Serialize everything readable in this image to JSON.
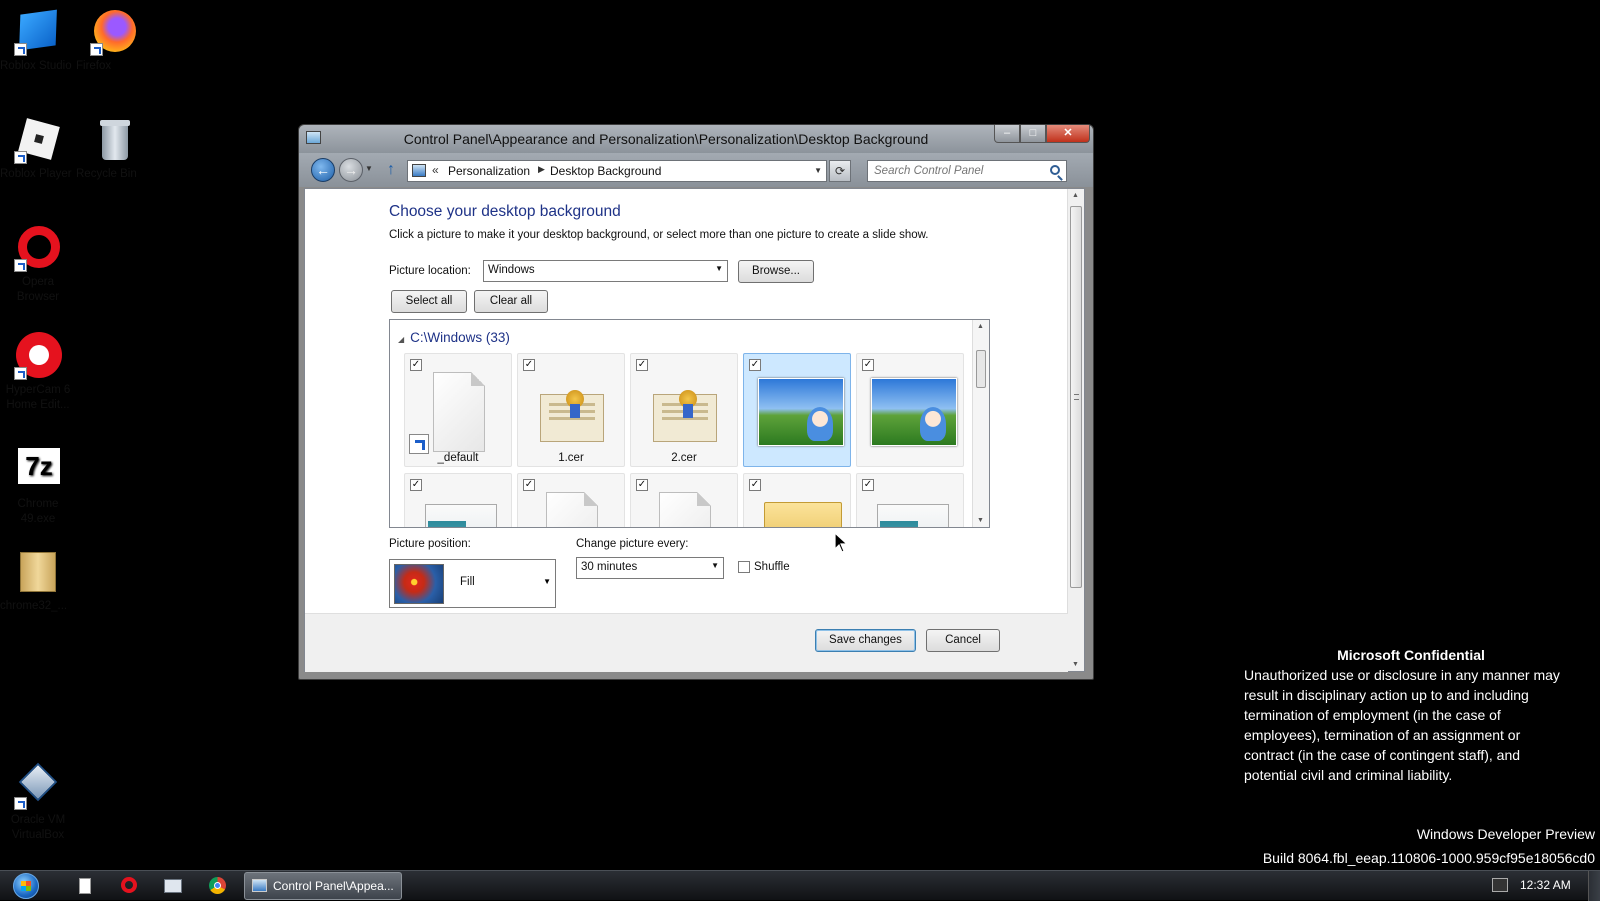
{
  "desktop": {
    "icons": [
      {
        "label": "Roblox Studio",
        "icon": "roblox-studio-icon"
      },
      {
        "label": "Firefox",
        "icon": "firefox-icon"
      },
      {
        "label": "Roblox Player",
        "icon": "roblox-player-icon"
      },
      {
        "label": "Recycle Bin",
        "icon": "recycle-bin-icon"
      },
      {
        "label": "Opera Browser",
        "icon": "opera-icon"
      },
      {
        "label": "HyperCam 6 Home Edit...",
        "icon": "hypercam-icon"
      },
      {
        "label": "Chrome 49.exe",
        "icon": "7zip-icon"
      },
      {
        "label": "chrome32_...",
        "icon": "folder-icon"
      },
      {
        "label": "Oracle VM VirtualBox",
        "icon": "virtualbox-icon"
      }
    ]
  },
  "window": {
    "title": "Control Panel\\Appearance and Personalization\\Personalization\\Desktop Background",
    "buttons": {
      "minimize": "–",
      "maximize": "□",
      "close": "✕"
    }
  },
  "address": {
    "chevron": "«",
    "crumbs": [
      "Personalization",
      "Desktop Background"
    ],
    "search_placeholder": "Search Control Panel"
  },
  "main": {
    "heading": "Choose your desktop background",
    "description": "Click a picture to make it your desktop background, or select more than one picture to create a slide show.",
    "picture_location_label": "Picture location:",
    "picture_location_value": "Windows",
    "browse_label": "Browse...",
    "select_all_label": "Select all",
    "clear_all_label": "Clear all",
    "group_header": "C:\\Windows (33)",
    "tiles_row1": [
      {
        "name": "_default",
        "checked": true,
        "kind": "file-shortcut"
      },
      {
        "name": "1.cer",
        "checked": true,
        "kind": "certificate"
      },
      {
        "name": "2.cer",
        "checked": true,
        "kind": "certificate"
      },
      {
        "name": "",
        "checked": true,
        "kind": "wallpaper",
        "selected": true
      },
      {
        "name": "",
        "checked": true,
        "kind": "wallpaper"
      }
    ],
    "tiles_row2": [
      {
        "checked": true,
        "kind": "window-thumb"
      },
      {
        "checked": true,
        "kind": "file"
      },
      {
        "checked": true,
        "kind": "text-file"
      },
      {
        "checked": true,
        "kind": "folder"
      },
      {
        "checked": true,
        "kind": "window-thumb"
      }
    ],
    "picture_position_label": "Picture position:",
    "picture_position_value": "Fill",
    "change_every_label": "Change picture every:",
    "change_every_value": "30 minutes",
    "shuffle_label": "Shuffle",
    "save_label": "Save changes",
    "cancel_label": "Cancel"
  },
  "watermark": {
    "title": "Microsoft Confidential",
    "lines": [
      "Unauthorized use or disclosure in any manner may",
      "result in disciplinary action up to and including",
      "termination of employment (in the case of",
      "employees), termination of an assignment or",
      "contract (in the case of contingent staff), and",
      "potential civil and criminal liability."
    ],
    "edition": "Windows Developer Preview",
    "build": "Build 8064.fbl_eeap.110806-1000.959cf95e18056cd0"
  },
  "taskbar": {
    "task_label": "Control Panel\\Appea...",
    "clock": "12:32 AM"
  }
}
